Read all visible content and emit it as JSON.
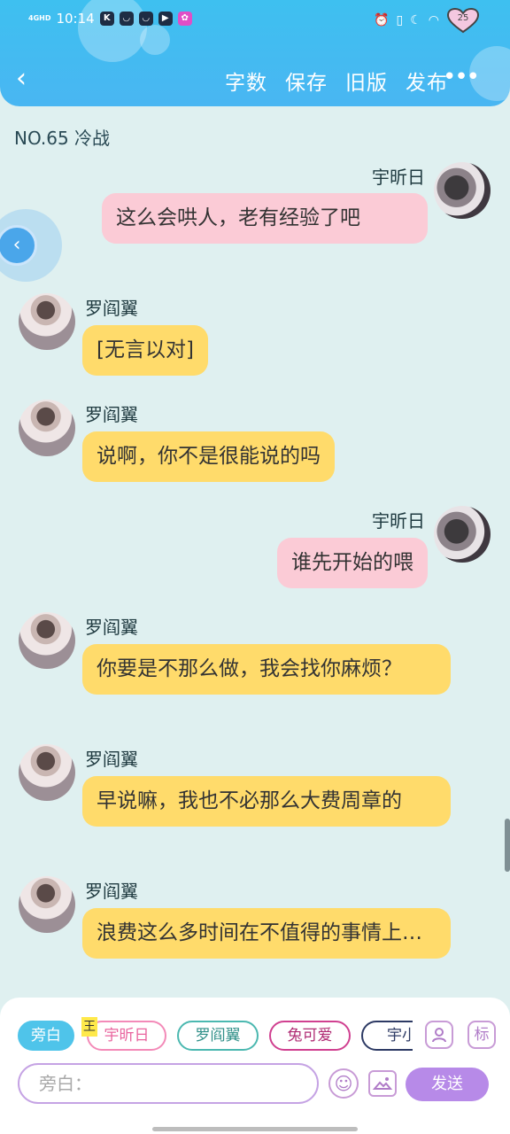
{
  "status": {
    "network": "4GHD",
    "time": "10:14",
    "apps": [
      "K",
      "",
      "",
      "",
      ""
    ],
    "battery": "25",
    "icons": [
      "alarm-icon",
      "vibrate-icon",
      "moon-icon",
      "wifi-icon",
      "battery-heart-icon"
    ]
  },
  "nav": {
    "back": "‹",
    "actions": [
      "字数",
      "保存",
      "旧版",
      "发布"
    ],
    "more": "•••"
  },
  "episode": {
    "title": "NO.65 冷战"
  },
  "messages": [
    {
      "side": "right",
      "name": "宇昕日",
      "text": "这么会哄人，老有经验了吧",
      "color": "pink"
    },
    {
      "side": "left",
      "name": "罗阎翼",
      "text": "[无言以对]",
      "color": "yellow"
    },
    {
      "side": "left",
      "name": "罗阎翼",
      "text": "说啊，你不是很能说的吗",
      "color": "yellow"
    },
    {
      "side": "right",
      "name": "宇昕日",
      "text": "谁先开始的喂",
      "color": "pink"
    },
    {
      "side": "left",
      "name": "罗阎翼",
      "text": "你要是不那么做，我会找你麻烦？",
      "color": "yellow"
    },
    {
      "side": "left",
      "name": "罗阎翼",
      "text": "早说嘛，我也不必那么大费周章的",
      "color": "yellow"
    },
    {
      "side": "left",
      "name": "罗阎翼",
      "text": "浪费这么多时间在不值得的事情上…",
      "color": "yellow"
    }
  ],
  "composer": {
    "roles": [
      "旁白",
      "宇昕日",
      "罗阎翼",
      "兔可爱",
      "宇小"
    ],
    "badge": "王",
    "person_icon": "person-icon",
    "tag_label": "标",
    "placeholder": "旁白：",
    "emoji": "☺",
    "image": "▣",
    "send": "发送"
  }
}
